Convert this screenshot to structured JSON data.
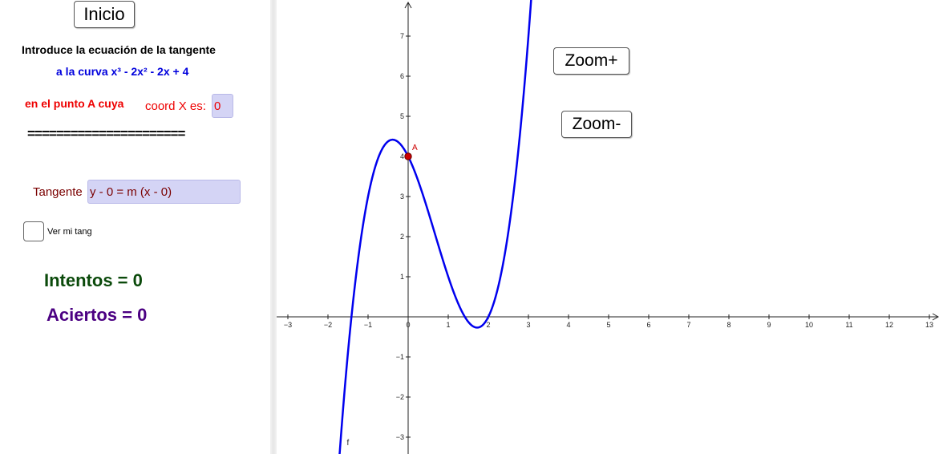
{
  "buttons": {
    "inicio": "Inicio",
    "zoom_in": "Zoom+",
    "zoom_out": "Zoom-"
  },
  "instructions": {
    "line1": "Introduce la ecuación de la tangente",
    "line2": "a la curva x³ - 2x² - 2x + 4",
    "line3": "en el punto A cuya",
    "coord_label": "coord X es:",
    "coord_value": "0",
    "separator": "======================"
  },
  "tangent": {
    "label": "Tangente",
    "value": "y - 0 = m (x - 0)"
  },
  "checkbox": {
    "label": "Ver mi tang",
    "checked": false
  },
  "stats": {
    "intentos": "Intentos = 0",
    "aciertos": "Aciertos = 0"
  },
  "colors": {
    "curve": "#0000ee",
    "point": "#cc0000",
    "instruction_blue": "#0000dd",
    "instruction_red": "#ee0000",
    "tangent_label": "#7a0000",
    "intentos": "#0b4a0b",
    "aciertos": "#4b0082"
  },
  "graph": {
    "function_label": "f",
    "point_label": "A",
    "point": {
      "x": 0,
      "y": 4
    },
    "x_range": [
      -3.3,
      13.3
    ],
    "y_range": [
      -3.4,
      7.9
    ],
    "x_ticks": [
      "−3",
      "−2",
      "−1",
      "1",
      "2",
      "3",
      "4",
      "5",
      "6",
      "7",
      "8",
      "9",
      "10",
      "11",
      "12",
      "13"
    ],
    "y_ticks": [
      "−3",
      "−2",
      "−1",
      "1",
      "2",
      "3",
      "4",
      "5",
      "6",
      "7"
    ],
    "origin_label": "0"
  }
}
